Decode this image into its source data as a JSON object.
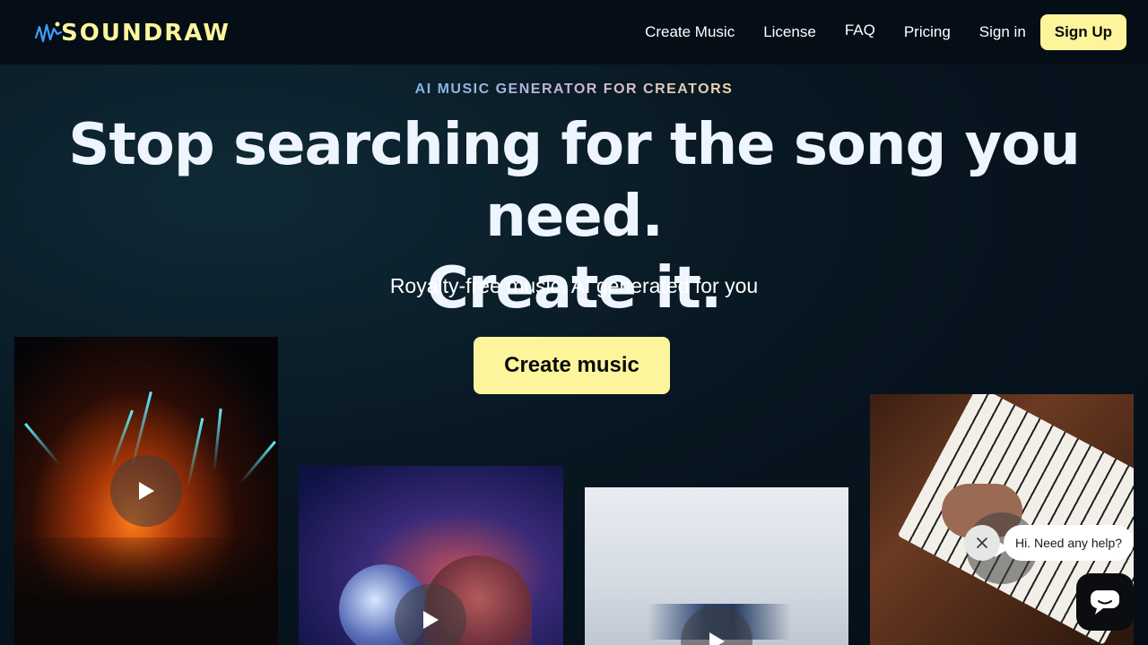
{
  "brand": {
    "name": "SOUNDRAW",
    "accent": "#fdf59b"
  },
  "nav": {
    "links": [
      "Create Music",
      "License",
      "FAQ",
      "Pricing",
      "Sign in"
    ],
    "signup_label": "Sign Up"
  },
  "hero": {
    "eyebrow": "AI MUSIC GENERATOR FOR CREATORS",
    "headline_line1": "Stop searching for the song you need.",
    "headline_line2": "Create it.",
    "subheadline": "Royalty-free music, AI generated for you",
    "cta_label": "Create music"
  },
  "cards": [
    {
      "icon": "play-icon"
    },
    {
      "icon": "play-icon"
    },
    {
      "icon": "play-icon"
    },
    {
      "icon": "play-icon"
    }
  ],
  "chat": {
    "prompt": "Hi. Need any help?",
    "close_icon": "close-icon",
    "launcher_icon": "chat-icon"
  }
}
